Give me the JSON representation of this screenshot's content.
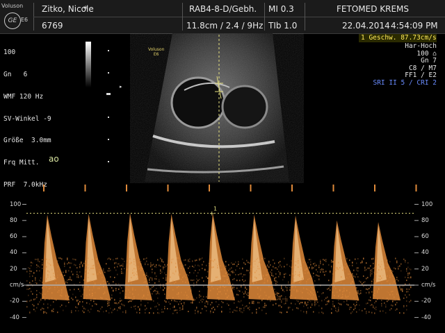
{
  "header": {
    "brand": "Voluson",
    "logo": "GE",
    "probe": "E6",
    "patient_name": "Zitko, Nicole",
    "marker": "*",
    "patient_id": "6769",
    "probe_preset": "RAB4-8-D/Gebh.",
    "depth_info": "11.8cm / 2.4 /  9Hz",
    "mi": "MI  0.3",
    "tib": "TIb  1.0",
    "institution": "FETOMED KREMS",
    "date": "22.04.2014",
    "time": "4:54:09 PM"
  },
  "left_params": [
    "100",
    "Gn   6",
    "WMF 120 Hz",
    "SV-Winkel -9",
    "Größe  3.0mm",
    "Frq Mitt.",
    "PRF  7.0kHz"
  ],
  "right_params": {
    "measurement": "1  Geschw. 87.73cm/s",
    "lines": [
      "Har-Hoch",
      "100 ⌂",
      "Gn   7",
      "C8 / M7",
      "FF1 / E2"
    ],
    "sri": "SRI II 5 / CRI 2"
  },
  "bmode_label": [
    "Voluson",
    "E6"
  ],
  "vessel_label": "ao",
  "cursor_label": "1",
  "doppler": {
    "left_ticks": [
      "100",
      "80",
      "60",
      "40",
      "20",
      "cm/s",
      "-20",
      "-40"
    ],
    "right_ticks": [
      "100",
      "80",
      "60",
      "40",
      "20",
      "cm/s",
      "-20",
      "-40"
    ],
    "peaks": [
      87,
      88,
      89,
      88,
      89,
      87,
      86,
      80,
      78
    ],
    "colors": {
      "spectrum": "#e08a3a",
      "highlight": "#ffd7a0",
      "baseline": "#b0b0b0",
      "cursor": "#e6e080"
    }
  }
}
